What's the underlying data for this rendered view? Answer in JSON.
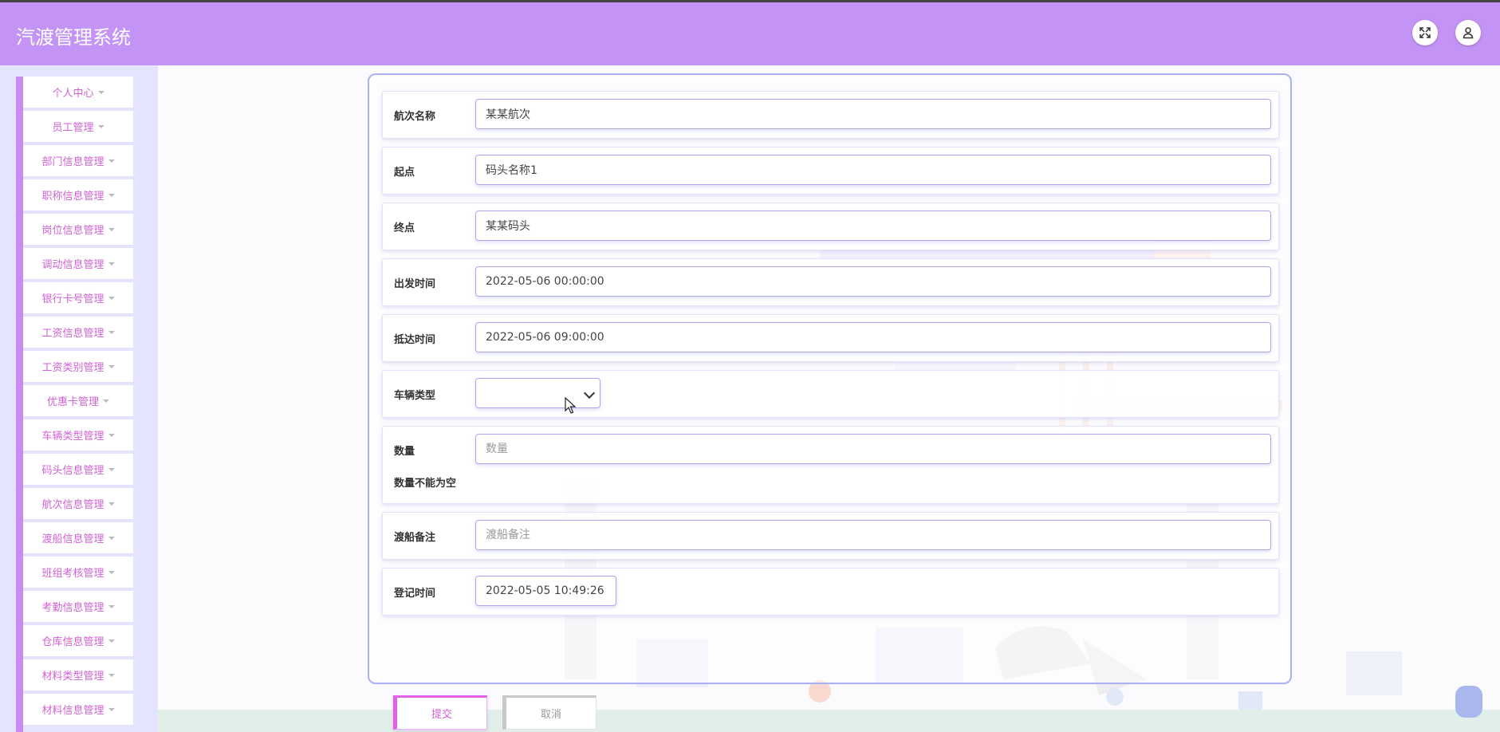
{
  "header": {
    "title": "汽渡管理系统",
    "icons": [
      "fullscreen-icon",
      "user-icon"
    ]
  },
  "sidebar": {
    "items": [
      {
        "label": "个人中心"
      },
      {
        "label": "员工管理"
      },
      {
        "label": "部门信息管理"
      },
      {
        "label": "职称信息管理"
      },
      {
        "label": "岗位信息管理"
      },
      {
        "label": "调动信息管理"
      },
      {
        "label": "银行卡号管理"
      },
      {
        "label": "工资信息管理"
      },
      {
        "label": "工资类别管理"
      },
      {
        "label": "优惠卡管理"
      },
      {
        "label": "车辆类型管理"
      },
      {
        "label": "码头信息管理"
      },
      {
        "label": "航次信息管理"
      },
      {
        "label": "渡船信息管理"
      },
      {
        "label": "班组考核管理"
      },
      {
        "label": "考勤信息管理"
      },
      {
        "label": "仓库信息管理"
      },
      {
        "label": "材料类型管理"
      },
      {
        "label": "材料信息管理"
      }
    ]
  },
  "form": {
    "voyage_name": {
      "label": "航次名称",
      "value": "某某航次"
    },
    "start_point": {
      "label": "起点",
      "value": "码头名称1"
    },
    "end_point": {
      "label": "终点",
      "value": "某某码头"
    },
    "departure_time": {
      "label": "出发时间",
      "value": "2022-05-06 00:00:00"
    },
    "arrival_time": {
      "label": "抵达时间",
      "value": "2022-05-06 09:00:00"
    },
    "vehicle_type": {
      "label": "车辆类型",
      "value": ""
    },
    "quantity": {
      "label": "数量",
      "placeholder": "数量",
      "error": "数量不能为空"
    },
    "ferry_remark": {
      "label": "渡船备注",
      "placeholder": "渡船备注"
    },
    "register_time": {
      "label": "登记时间",
      "value": "2022-05-05 10:49:26"
    },
    "submit_label": "提交",
    "cancel_label": "取消"
  }
}
